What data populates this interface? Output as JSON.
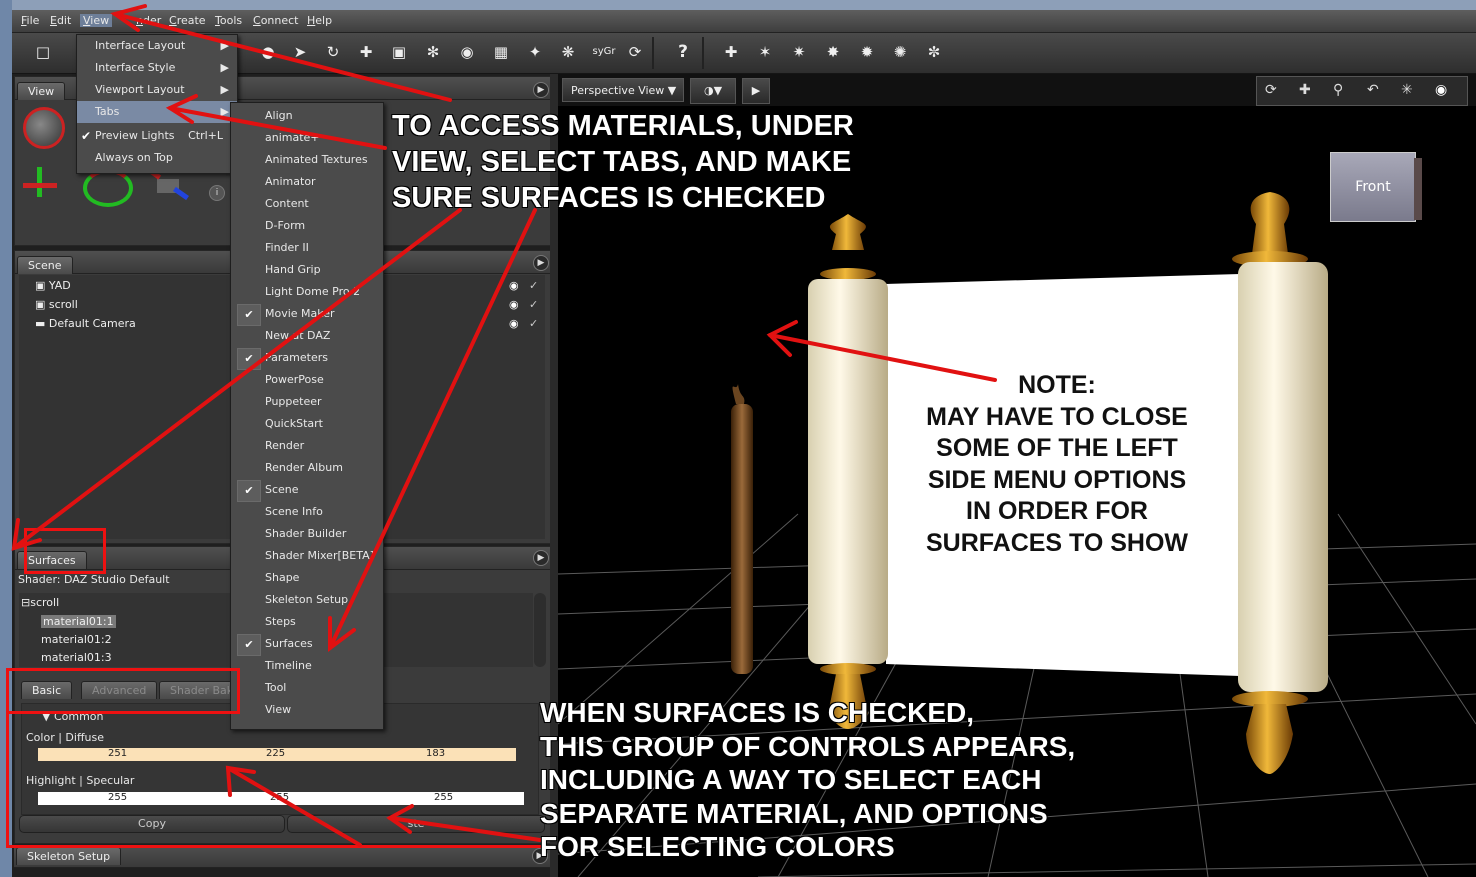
{
  "menubar": {
    "items": [
      "File",
      "Edit",
      "View",
      "Render",
      "Create",
      "Tools",
      "Connect",
      "Help"
    ],
    "visible_labels": {
      "file": "File",
      "edit": "Edit",
      "view": "View",
      "render_partial": "nder",
      "create": "Create",
      "tools": "Tools",
      "connect": "Connect",
      "help": "Help"
    }
  },
  "toolbar": {
    "sygr_label": "syGr"
  },
  "view_menu": {
    "items": [
      {
        "label": "Interface Layout",
        "submenu": true
      },
      {
        "label": "Interface Style",
        "submenu": true
      },
      {
        "label": "Viewport Layout",
        "submenu": true
      },
      {
        "label": "Tabs",
        "submenu": true,
        "highlighted": true
      },
      {
        "label": "Preview Lights",
        "shortcut": "Ctrl+L",
        "checked": true
      },
      {
        "label": "Always on Top"
      }
    ]
  },
  "tabs_menu": {
    "items": [
      {
        "label": "Align"
      },
      {
        "label": "animate+"
      },
      {
        "label": "Animated Textures"
      },
      {
        "label": "Animator"
      },
      {
        "label": "Content"
      },
      {
        "label": "D-Form"
      },
      {
        "label": "Finder II"
      },
      {
        "label": "Hand Grip"
      },
      {
        "label": "Light Dome Pro 2"
      },
      {
        "label": "Movie Maker",
        "checked": true
      },
      {
        "label": "New at DAZ"
      },
      {
        "label": "Parameters",
        "checked": true
      },
      {
        "label": "PowerPose"
      },
      {
        "label": "Puppeteer"
      },
      {
        "label": "QuickStart"
      },
      {
        "label": "Render"
      },
      {
        "label": "Render Album"
      },
      {
        "label": "Scene",
        "checked": true
      },
      {
        "label": "Scene Info"
      },
      {
        "label": "Shader Builder"
      },
      {
        "label": "Shader Mixer[BETA]"
      },
      {
        "label": "Shape"
      },
      {
        "label": "Skeleton Setup"
      },
      {
        "label": "Steps"
      },
      {
        "label": "Surfaces",
        "checked": true
      },
      {
        "label": "Timeline"
      },
      {
        "label": "Tool"
      },
      {
        "label": "View"
      }
    ]
  },
  "left_panel": {
    "view_tab": "View",
    "scene_tab": "Scene",
    "scene_items": [
      "YAD",
      "scroll",
      "Default Camera"
    ],
    "surfaces_tab": "Surfaces",
    "shader_label": "Shader: DAZ Studio Default",
    "tree_root": "scroll",
    "materials": [
      "material01:1",
      "material01:2",
      "material01:3"
    ],
    "subtabs": [
      "Basic",
      "Advanced",
      "Shader Bak"
    ],
    "common_label": "Common",
    "color_diffuse_label": "Color | Diffuse",
    "color_diffuse": {
      "r": "251",
      "g": "225",
      "b": "183",
      "hex": "#fbe1b7"
    },
    "highlight_label": "Highlight | Specular",
    "highlight": {
      "r": "255",
      "g": "255",
      "b": "255"
    },
    "copy_button": "Copy",
    "paste_button": "ste",
    "skeleton_setup_tab": "Skeleton Setup"
  },
  "viewport": {
    "view_dropdown": "Perspective View",
    "cube_label": "Front"
  },
  "annotations": {
    "top": [
      "TO ACCESS MATERIALS, UNDER",
      "VIEW, SELECT TABS, AND MAKE",
      "SURE SURFACES IS CHECKED"
    ],
    "note": [
      "NOTE:",
      "MAY HAVE TO CLOSE",
      "SOME OF THE LEFT",
      "SIDE MENU OPTIONS",
      "IN ORDER FOR",
      "SURFACES TO SHOW"
    ],
    "bottom": [
      "WHEN SURFACES IS CHECKED,",
      "THIS GROUP OF CONTROLS APPEARS,",
      "INCLUDING A WAY TO SELECT EACH",
      "SEPARATE MATERIAL, AND OPTIONS",
      "FOR SELECTING COLORS"
    ]
  },
  "colors": {
    "annotation_red": "#e11111",
    "viewport_bg": "#000000",
    "scroll_paper": "#ffffff",
    "wood": "#8a5a2a",
    "gold": "#c8901a"
  }
}
